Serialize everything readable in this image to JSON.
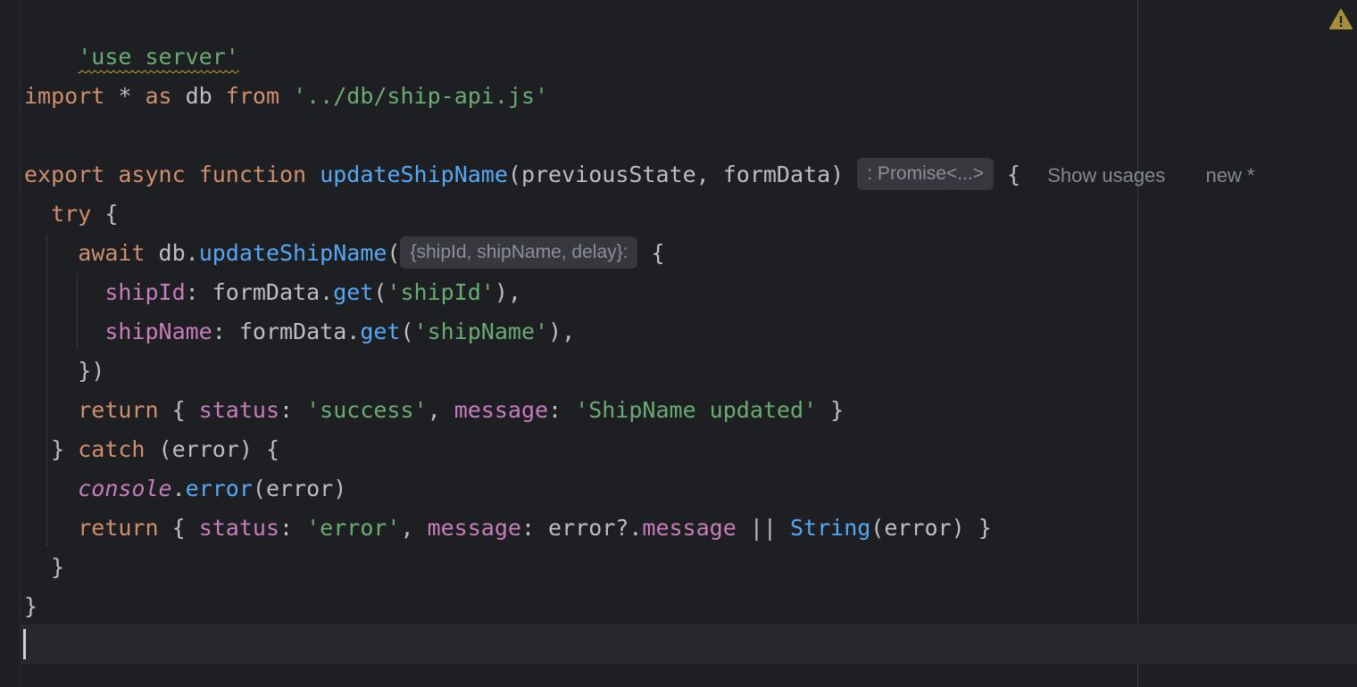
{
  "theme": {
    "background": "#1e1f22",
    "keyword": "#cf8e6d",
    "string": "#6aab73",
    "function": "#56a8f5",
    "property": "#c77dbb",
    "text": "#bcbec4",
    "warning": "#c5a332"
  },
  "warning_icon": "warning-triangle-icon",
  "code": {
    "l1": {
      "directive": "'use server'"
    },
    "l3": {
      "kw_import": "import",
      "star": " * ",
      "kw_as": "as",
      "ident": " db ",
      "kw_from": "from",
      "sp": " ",
      "path": "'../db/ship-api.js'"
    },
    "l5": {
      "kw_export": "export",
      "sp1": " ",
      "kw_async": "async",
      "sp2": " ",
      "kw_function": "function",
      "sp3": " ",
      "fn_name": "updateShipName",
      "params": "(previousState, formData)",
      "return_hint": ": Promise<...>",
      "brace": " {",
      "lens_usages": "Show usages",
      "lens_new": "new *"
    },
    "l6": {
      "kw_try": "try",
      "rest": " {"
    },
    "l7": {
      "kw_await": "await",
      "obj": " db.",
      "fn_call": "updateShipName",
      "paren": "(",
      "param_hint": "{shipId, shipName, delay}:",
      "brace": " {"
    },
    "l8": {
      "prop": "shipId",
      "colon": ": formData.",
      "fn_get": "get",
      "open": "(",
      "str": "'shipId'",
      "close": "),"
    },
    "l9": {
      "prop": "shipName",
      "colon": ": formData.",
      "fn_get": "get",
      "open": "(",
      "str": "'shipName'",
      "close": "),"
    },
    "l10": {
      "text": "})"
    },
    "l11": {
      "kw_return": "return",
      "open": " { ",
      "prop_status": "status",
      "c1": ": ",
      "str_status": "'success'",
      "sep": ", ",
      "prop_message": "message",
      "c2": ": ",
      "str_message": "'ShipName updated'",
      "close": " }"
    },
    "l12": {
      "close": "} ",
      "kw_catch": "catch",
      "rest": " (error) {"
    },
    "l13": {
      "glob": "console",
      "dot": ".",
      "fn_error": "error",
      "rest": "(error)"
    },
    "l14": {
      "kw_return": "return",
      "open": " { ",
      "prop_status": "status",
      "c1": ": ",
      "str_status": "'error'",
      "sep": ", ",
      "prop_message": "message",
      "c2": ": error?.",
      "prop_message2": "message",
      "or": " || ",
      "fn_string": "String",
      "close": "(error) }"
    },
    "l15": {
      "text": "}"
    },
    "l16": {
      "text": "}"
    }
  }
}
